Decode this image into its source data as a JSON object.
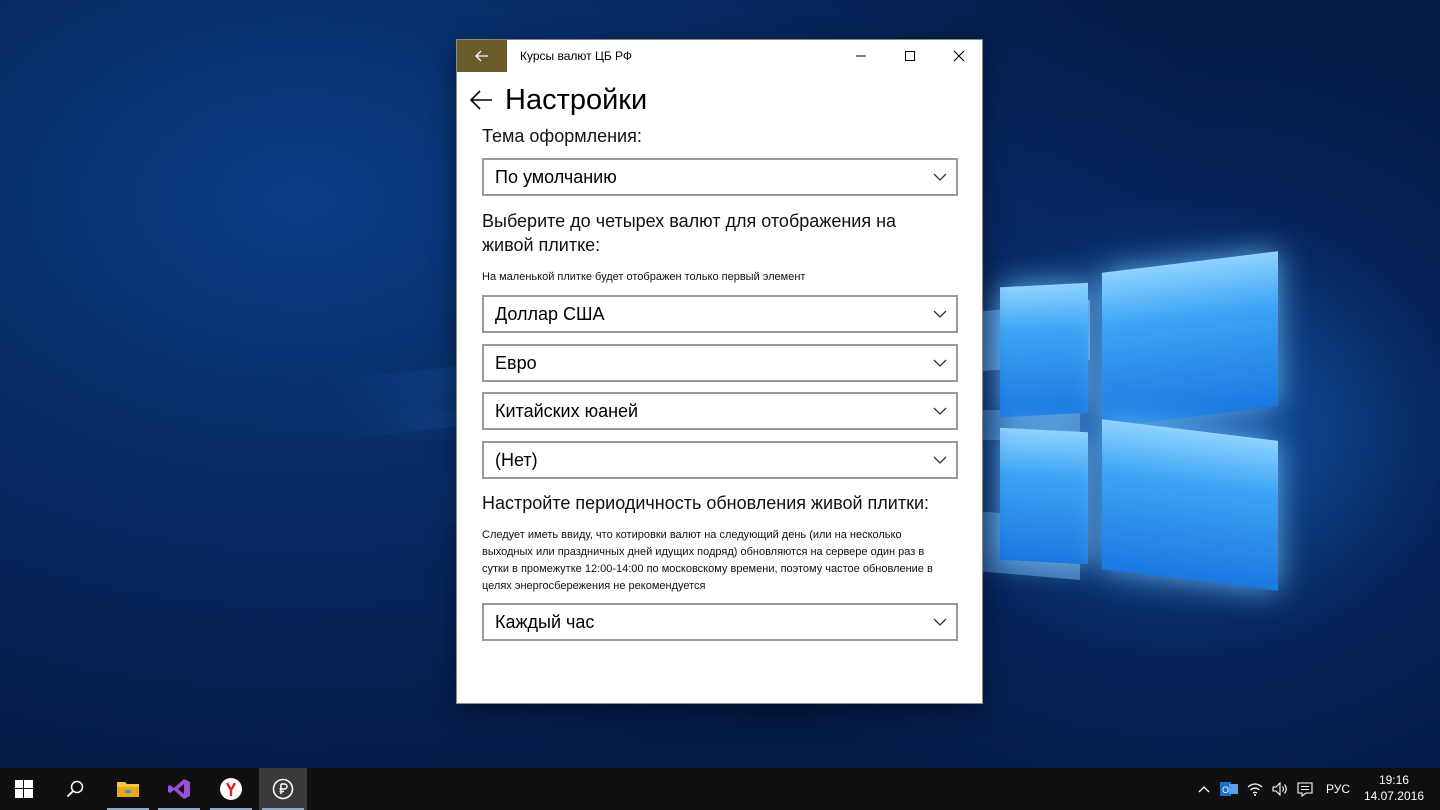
{
  "window": {
    "title": "Курсы валют ЦБ РФ",
    "accent_color": "#6b5a2a",
    "buttons": [
      "back-arrow-icon",
      "minimize-icon",
      "maximize-icon",
      "close-icon"
    ]
  },
  "page": {
    "title": "Настройки"
  },
  "theme": {
    "label": "Тема оформления:",
    "selected": "По умолчанию"
  },
  "currencies": {
    "label": "Выберите до четырех валют для отображения на живой плитке:",
    "note": "На маленькой плитке будет отображен только первый элемент",
    "slots": [
      {
        "selected": "Доллар США"
      },
      {
        "selected": "Евро"
      },
      {
        "selected": "Китайских юаней"
      },
      {
        "selected": "(Нет)"
      }
    ]
  },
  "update": {
    "label": "Настройте периодичность обновления живой плитки:",
    "note": "Следует иметь ввиду, что котировки валют на следующий день (или на несколько выходных или праздничных дней идущих подряд) обновляются на сервере один раз в сутки в промежутке 12:00-14:00 по московскому времени, поэтому частое обновление в целях энергосбережения не рекомендуется",
    "selected": "Каждый час"
  },
  "taskbar": {
    "items": [
      "windows-start-icon",
      "search-icon",
      "file-explorer-icon",
      "visual-studio-icon",
      "yandex-browser-icon",
      "currency-app-icon"
    ],
    "tray": {
      "language": "РУС",
      "time": "19:16",
      "date": "14.07.2016"
    }
  }
}
